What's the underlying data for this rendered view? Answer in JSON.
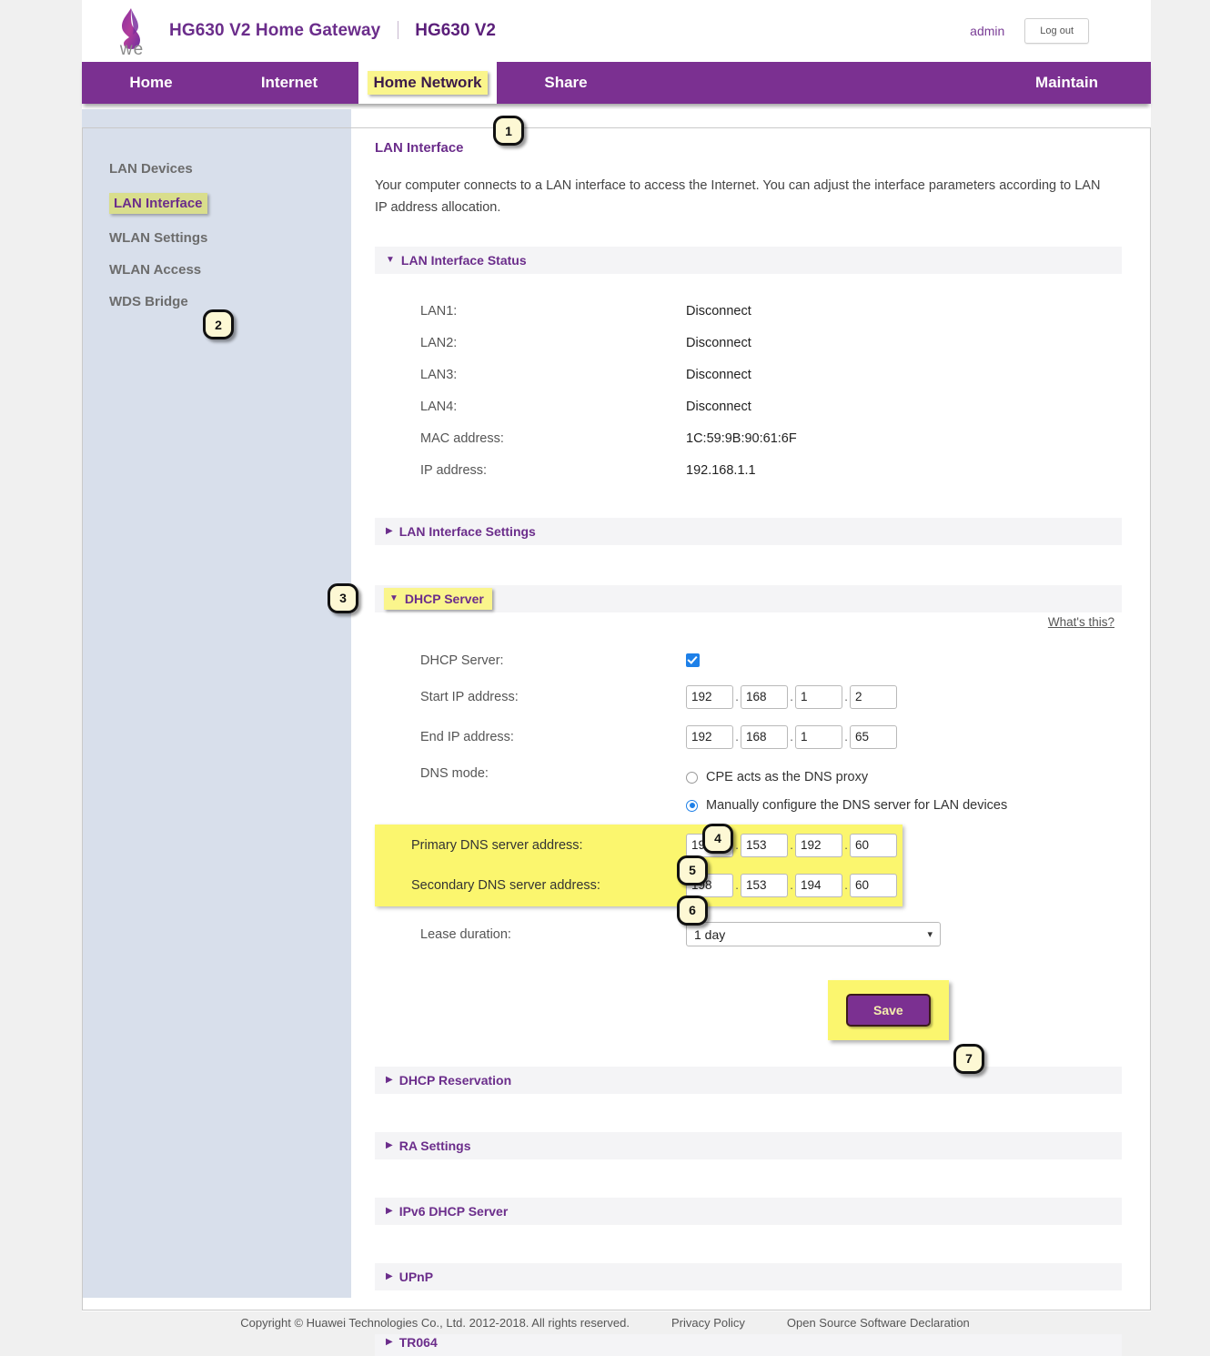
{
  "header": {
    "logo_text": "we",
    "title": "HG630 V2 Home Gateway",
    "model": "HG630 V2",
    "user": "admin",
    "logout_label": "Log out"
  },
  "nav": {
    "items": [
      {
        "label": "Home",
        "active": false
      },
      {
        "label": "Internet",
        "active": false
      },
      {
        "label": "Home Network",
        "active": true
      },
      {
        "label": "Share",
        "active": false
      },
      {
        "label": "Maintain",
        "active": false
      }
    ]
  },
  "sidebar": {
    "items": [
      {
        "label": "LAN Devices",
        "active": false
      },
      {
        "label": "LAN Interface",
        "active": true
      },
      {
        "label": "WLAN Settings",
        "active": false
      },
      {
        "label": "WLAN Access",
        "active": false
      },
      {
        "label": "WDS Bridge",
        "active": false
      }
    ]
  },
  "main": {
    "page_title": "LAN Interface",
    "intro": "Your computer connects to a LAN interface to access the Internet. You can adjust the interface parameters according to LAN IP address allocation.",
    "status_section": {
      "label": "LAN Interface Status",
      "arrow": "▼",
      "rows": [
        {
          "label": "LAN1:",
          "value": "Disconnect"
        },
        {
          "label": "LAN2:",
          "value": "Disconnect"
        },
        {
          "label": "LAN3:",
          "value": "Disconnect"
        },
        {
          "label": "LAN4:",
          "value": "Disconnect"
        },
        {
          "label": "MAC address:",
          "value": "1C:59:9B:90:61:6F"
        },
        {
          "label": "IP address:",
          "value": "192.168.1.1"
        }
      ]
    },
    "settings_section": {
      "label": "LAN Interface Settings",
      "arrow": "▶"
    },
    "dhcp_section": {
      "label": "DHCP Server",
      "arrow": "▼",
      "whats_this": "What's this?",
      "dhcp_server_label": "DHCP Server:",
      "dhcp_server_checked": true,
      "start_ip_label": "Start IP address:",
      "start_ip": [
        "192",
        "168",
        "1",
        "2"
      ],
      "end_ip_label": "End IP address:",
      "end_ip": [
        "192",
        "168",
        "1",
        "65"
      ],
      "dns_mode_label": "DNS mode:",
      "dns_mode_options": [
        {
          "label": "CPE acts as the DNS proxy",
          "selected": false
        },
        {
          "label": "Manually configure the DNS server for LAN devices",
          "selected": true
        }
      ],
      "primary_dns_label": "Primary DNS server address:",
      "primary_dns": [
        "198",
        "153",
        "192",
        "60"
      ],
      "secondary_dns_label": "Secondary DNS server address:",
      "secondary_dns": [
        "198",
        "153",
        "194",
        "60"
      ],
      "lease_label": "Lease duration:",
      "lease_value": "1 day",
      "save_label": "Save"
    },
    "collapsed_sections": [
      {
        "label": "DHCP Reservation",
        "arrow": "▶"
      },
      {
        "label": "RA Settings",
        "arrow": "▶"
      },
      {
        "label": "IPv6 DHCP Server",
        "arrow": "▶"
      },
      {
        "label": "UPnP",
        "arrow": "▶"
      },
      {
        "label": "TR064",
        "arrow": "▶"
      }
    ]
  },
  "callouts": [
    {
      "number": "1"
    },
    {
      "number": "2"
    },
    {
      "number": "3"
    },
    {
      "number": "4"
    },
    {
      "number": "5"
    },
    {
      "number": "6"
    },
    {
      "number": "7"
    }
  ],
  "footer": {
    "copyright": "Copyright © Huawei Technologies Co., Ltd. 2012-2018. All rights reserved.",
    "privacy": "Privacy Policy",
    "opensource": "Open Source Software Declaration"
  },
  "colors": {
    "brand_purple": "#7b3091",
    "highlight_yellow": "#faf58c",
    "dns_yellow": "#fbf66e",
    "sidebar_bg": "#d8dfeb",
    "accent_blue": "#1e80e8"
  }
}
